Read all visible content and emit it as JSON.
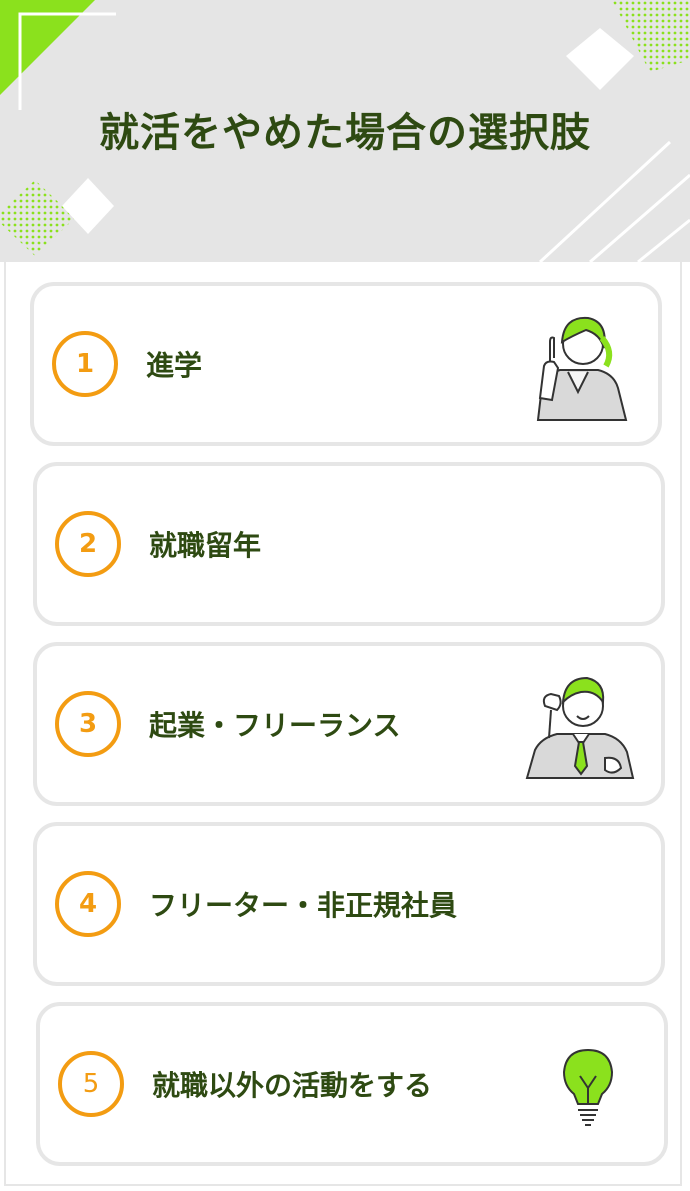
{
  "header": {
    "title": "就活をやめた場合の選択肢"
  },
  "colors": {
    "accent_orange": "#f39c12",
    "lime": "#8be11d",
    "title_green": "#2e4a12",
    "header_bg": "#e5e5e5"
  },
  "options": [
    {
      "number": "1",
      "label": "進学",
      "illustration": "pointing-woman-icon"
    },
    {
      "number": "2",
      "label": "就職留年"
    },
    {
      "number": "3",
      "label": "起業・フリーランス",
      "illustration": "cheering-man-icon"
    },
    {
      "number": "4",
      "label": "フリーター・非正規社員"
    },
    {
      "number": "5",
      "label": "就職以外の活動をする",
      "illustration": "light-bulb-icon"
    }
  ]
}
